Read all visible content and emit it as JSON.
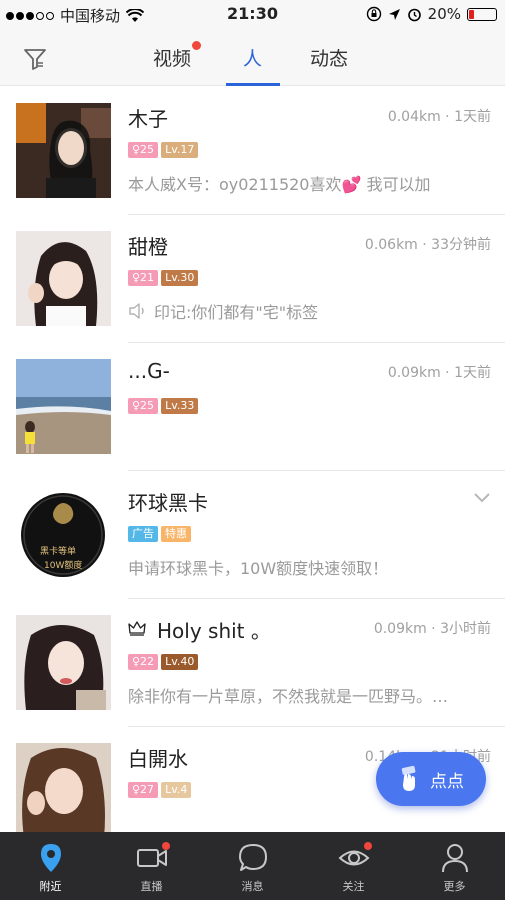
{
  "status_bar": {
    "carrier": "中国移动",
    "time": "21:30",
    "battery": "20%"
  },
  "top_nav": {
    "tabs": [
      "视频",
      "人",
      "动态"
    ],
    "active_tab": "人"
  },
  "people": [
    {
      "name": "木子",
      "distance_time": "0.04km · 1天前",
      "age_badge": "♀25",
      "level_badge": "Lv.17",
      "level_color": "#d9ad7c",
      "subtitle": "本人威X号：oy0211520喜欢💕 我可以加"
    },
    {
      "name": "甜橙",
      "distance_time": "0.06km · 33分钟前",
      "age_badge": "♀21",
      "level_badge": "Lv.30",
      "level_color": "#c07a47",
      "subtitle": "印记:你们都有\"宅\"标签"
    },
    {
      "name": "...G-",
      "distance_time": "0.09km · 1天前",
      "age_badge": "♀25",
      "level_badge": "Lv.33",
      "level_color": "#c07a47",
      "subtitle": ""
    },
    {
      "name": "环球黑卡",
      "distance_time": "",
      "ad_badge": "广告",
      "promo_badge": "特惠",
      "subtitle": "申请环球黑卡，10W额度快速领取！",
      "avatar_text_top": "黑卡等单",
      "avatar_text_bottom": "10W额度"
    },
    {
      "name": "Holy shit 。",
      "distance_time": "0.09km · 3小时前",
      "age_badge": "♀22",
      "level_badge": "Lv.40",
      "level_color": "#9b5a2c",
      "subtitle": "除非你有一片草原，不然我就是一匹野马。…"
    },
    {
      "name": "白開水",
      "distance_time": "0.14km · 21小时前",
      "age_badge": "♀27",
      "level_badge": "Lv.4",
      "level_color": "#e6c79e",
      "subtitle": ""
    }
  ],
  "fab": {
    "label": "点点"
  },
  "tabbar": {
    "items": [
      "附近",
      "直播",
      "消息",
      "关注",
      "更多"
    ],
    "active": "附近"
  },
  "colors": {
    "accent": "#2b63d9",
    "badge_red": "#f0463c",
    "tabbar_bg": "#2a2a2d"
  }
}
